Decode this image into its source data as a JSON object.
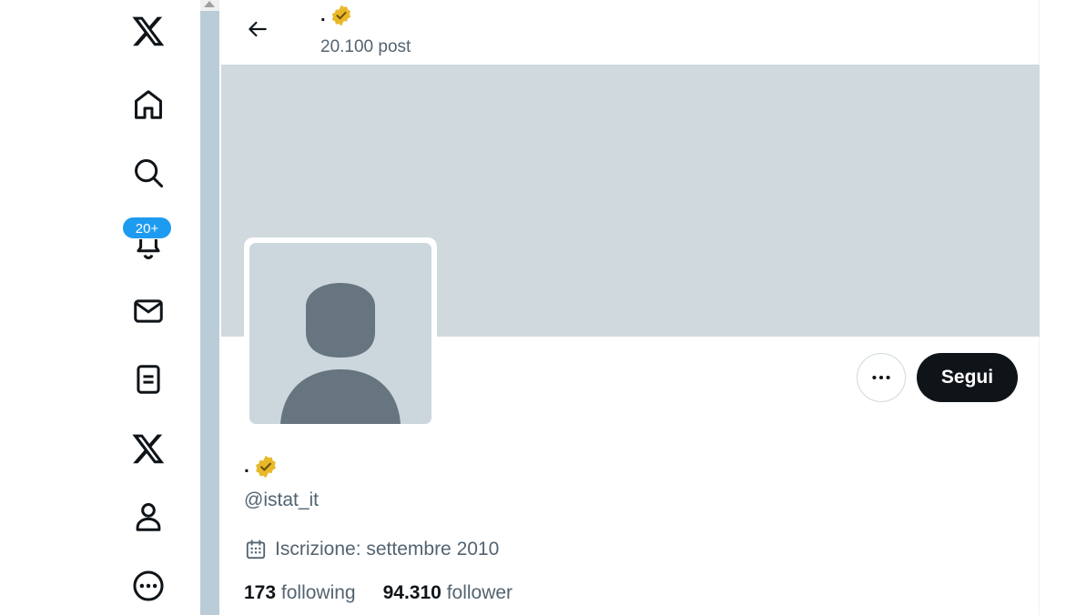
{
  "nav": {
    "notifications_badge": "20+"
  },
  "header": {
    "display_name": ".",
    "post_count": "20.100 post"
  },
  "profile": {
    "display_name": ".",
    "handle": "@istat_it",
    "joined": "Iscrizione: settembre 2010",
    "following_count": "173",
    "following_label": "following",
    "followers_count": "94.310",
    "followers_label": "follower"
  },
  "actions": {
    "follow_label": "Segui"
  },
  "colors": {
    "accent": "#1d9bf0",
    "banner": "#cfd9de",
    "verified_gold": "#e8b829",
    "text_secondary": "#536471"
  },
  "icons": [
    "x-logo-icon",
    "home-icon",
    "search-icon",
    "bell-icon",
    "mail-icon",
    "lists-icon",
    "premium-x-icon",
    "profile-icon",
    "more-circle-icon",
    "back-arrow-icon",
    "verified-badge-icon",
    "calendar-icon",
    "more-dots-icon"
  ]
}
